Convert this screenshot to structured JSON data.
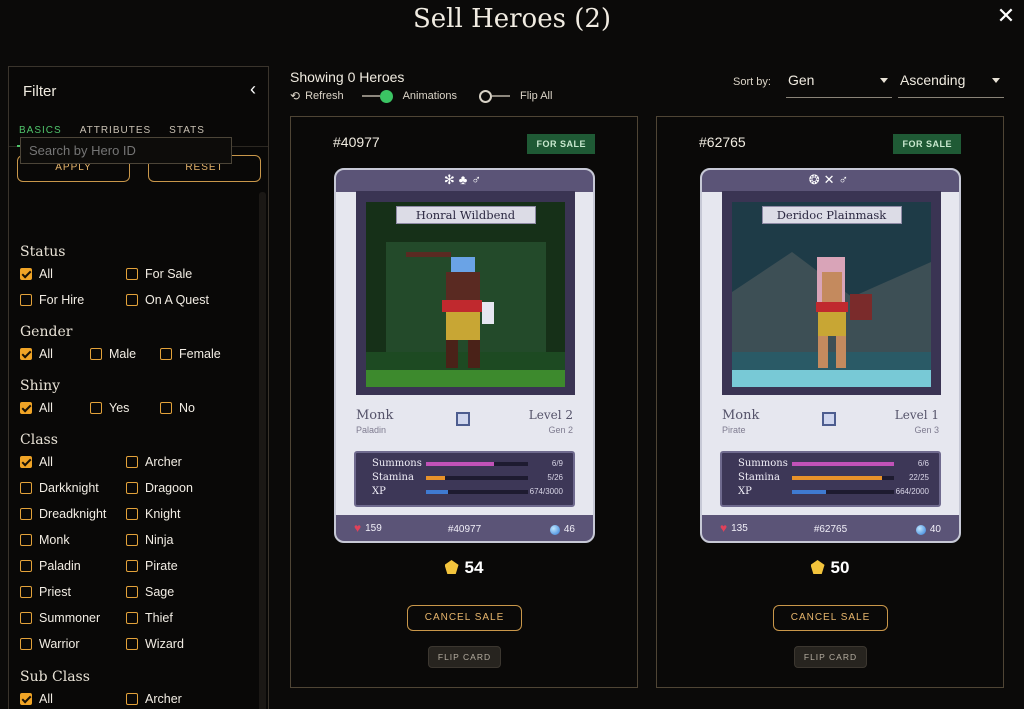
{
  "modal": {
    "title": "Sell Heroes (2)"
  },
  "sidebar": {
    "title": "Filter",
    "tabs": [
      "BASICS",
      "ATTRIBUTES",
      "STATS"
    ],
    "apply_label": "APPLY",
    "reset_label": "RESET",
    "search_placeholder": "Search by Hero ID",
    "status": {
      "title": "Status",
      "options": [
        "All",
        "For Sale",
        "For Hire",
        "On A Quest"
      ]
    },
    "gender": {
      "title": "Gender",
      "options": [
        "All",
        "Male",
        "Female"
      ]
    },
    "shiny": {
      "title": "Shiny",
      "options": [
        "All",
        "Yes",
        "No"
      ]
    },
    "class": {
      "title": "Class",
      "options": [
        "All",
        "Archer",
        "Darkknight",
        "Dragoon",
        "Dreadknight",
        "Knight",
        "Monk",
        "Ninja",
        "Paladin",
        "Pirate",
        "Priest",
        "Sage",
        "Summoner",
        "Thief",
        "Warrior",
        "Wizard"
      ]
    },
    "subclass": {
      "title": "Sub Class",
      "options": [
        "All",
        "Archer"
      ]
    }
  },
  "main": {
    "showing": "Showing 0 Heroes",
    "refresh_label": "Refresh",
    "animations_label": "Animations",
    "flip_all_label": "Flip All",
    "sort_label": "Sort by:",
    "sort_value": "Gen",
    "order_value": "Ascending"
  },
  "heroes": [
    {
      "id": "#40977",
      "badge": "FOR SALE",
      "name": "Honral Wildbend",
      "class": "Monk",
      "subclass": "Paladin",
      "level": "Level 2",
      "gen": "Gen 2",
      "summons": "6/9",
      "summons_frac": 0.67,
      "stamina": "5/26",
      "stamina_frac": 0.19,
      "xp": "674/3000",
      "xp_frac": 0.22,
      "hp": "159",
      "mp": "46",
      "price": "54",
      "cancel_label": "CANCEL SALE",
      "flip_label": "FLIP CARD"
    },
    {
      "id": "#62765",
      "badge": "FOR SALE",
      "name": "Deridoc Plainmask",
      "class": "Monk",
      "subclass": "Pirate",
      "level": "Level 1",
      "gen": "Gen 3",
      "summons": "6/6",
      "summons_frac": 1.0,
      "stamina": "22/25",
      "stamina_frac": 0.88,
      "xp": "664/2000",
      "xp_frac": 0.33,
      "hp": "135",
      "mp": "40",
      "price": "50",
      "cancel_label": "CANCEL SALE",
      "flip_label": "FLIP CARD"
    }
  ],
  "colors": {
    "accent_green": "#3bc463",
    "gold": "#e6b56c",
    "checkbox": "#f0a426",
    "summons_bar": "#c152b8",
    "stamina_bar": "#e8922a",
    "xp_bar": "#3f7ad1"
  }
}
